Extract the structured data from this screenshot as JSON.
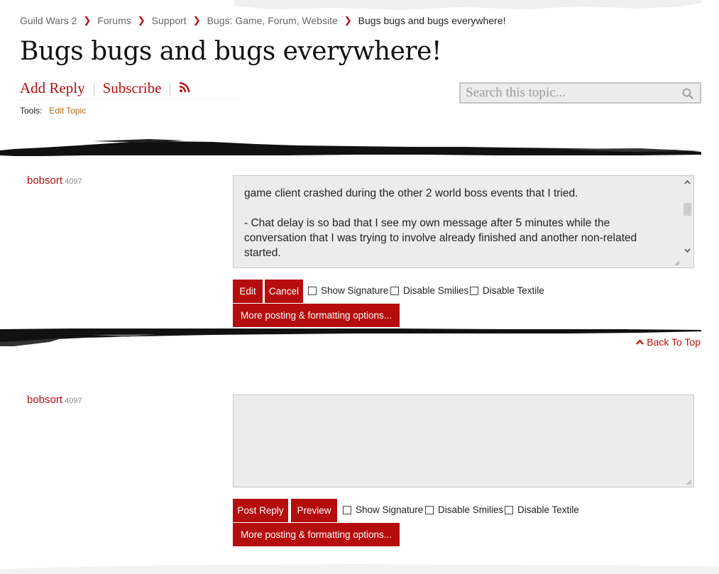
{
  "breadcrumb": {
    "items": [
      "Guild Wars 2",
      "Forums",
      "Support",
      "Bugs: Game, Forum, Website"
    ],
    "current": "Bugs bugs and bugs everywhere!"
  },
  "topic": {
    "title": "Bugs bugs and bugs everywhere!",
    "add_reply": "Add Reply",
    "subscribe": "Subscribe",
    "rss_icon": "rss-icon"
  },
  "tools": {
    "label": "Tools:",
    "edit_topic": "Edit Topic"
  },
  "search": {
    "placeholder": "Search this topic...",
    "icon": "search-icon"
  },
  "edit_post": {
    "username": "bobsort",
    "account": ".4097",
    "lines": [
      "game client crashed during the other 2 world boss events that I tried.",
      "- Chat delay is so bad that I see my own message after 5 minutes while the",
      "conversation that I was trying to involve already finished and another non-related",
      "started."
    ],
    "edit_label": "Edit",
    "cancel_label": "Cancel",
    "show_signature": "Show Signature",
    "disable_smilies": "Disable Smilies",
    "disable_textile": "Disable Textile",
    "more_options": "More posting & formatting options..."
  },
  "back_to_top": "Back To Top",
  "reply_post": {
    "username": "bobsort",
    "account": ".4097",
    "post_reply_label": "Post Reply",
    "preview_label": "Preview",
    "show_signature": "Show Signature",
    "disable_smilies": "Disable Smilies",
    "disable_textile": "Disable Textile",
    "more_options": "More posting & formatting options..."
  },
  "colors": {
    "accent": "#b50d0d",
    "tools_link": "#b06a1a",
    "field_bg": "#ececec"
  }
}
